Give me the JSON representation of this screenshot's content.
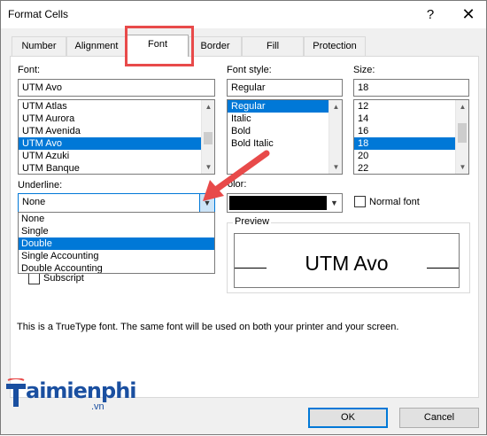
{
  "window": {
    "title": "Format Cells",
    "help_glyph": "?",
    "close_glyph": "✕"
  },
  "tabs": [
    {
      "label": "Number"
    },
    {
      "label": "Alignment"
    },
    {
      "label": "Font",
      "active": true
    },
    {
      "label": "Border"
    },
    {
      "label": "Fill"
    },
    {
      "label": "Protection"
    }
  ],
  "font": {
    "label": "Font:",
    "value": "UTM Avo",
    "list": [
      "UTM Atlas",
      "UTM Aurora",
      "UTM Avenida",
      "UTM Avo",
      "UTM Azuki",
      "UTM Banque"
    ],
    "selected": "UTM Avo"
  },
  "font_style": {
    "label": "Font style:",
    "value": "Regular",
    "list": [
      "Regular",
      "Italic",
      "Bold",
      "Bold Italic"
    ],
    "selected": "Regular"
  },
  "size": {
    "label": "Size:",
    "value": "18",
    "list": [
      "12",
      "14",
      "16",
      "18",
      "20",
      "22"
    ],
    "selected": "18"
  },
  "underline": {
    "label": "Underline:",
    "value": "None",
    "options": [
      "None",
      "Single",
      "Double",
      "Single Accounting",
      "Double Accounting"
    ],
    "highlighted": "Double"
  },
  "color": {
    "label": "olor:",
    "value": "#000000"
  },
  "normal_font": {
    "label": "Normal font",
    "checked": false
  },
  "effects": {
    "subscript_label": "Subscript"
  },
  "preview": {
    "label": "Preview",
    "text": "UTM Avo"
  },
  "info": "This is a TrueType font.  The same font will be used on both your printer and your screen.",
  "buttons": {
    "ok": "OK",
    "cancel": "Cancel"
  },
  "watermark": {
    "brand": "aimienphi",
    "sub": ".vn"
  },
  "colors": {
    "selection": "#0078d7",
    "annotation": "#e84a4a",
    "brand": "#1a4fa0"
  }
}
